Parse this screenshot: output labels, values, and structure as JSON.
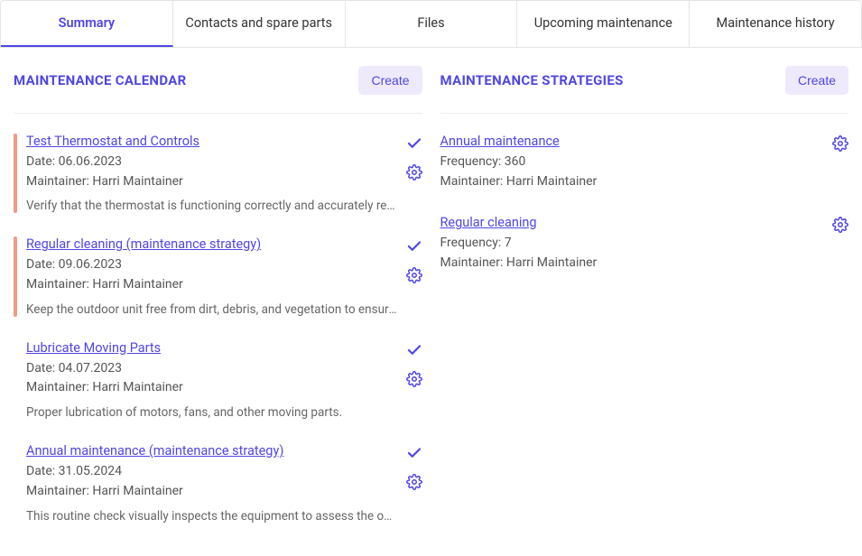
{
  "tabs": [
    {
      "label": "Summary",
      "active": true
    },
    {
      "label": "Contacts and spare parts",
      "active": false
    },
    {
      "label": "Files",
      "active": false
    },
    {
      "label": "Upcoming maintenance",
      "active": false
    },
    {
      "label": "Maintenance history",
      "active": false
    }
  ],
  "calendar": {
    "title": "MAINTENANCE CALENDAR",
    "create_label": "Create",
    "items": [
      {
        "title": "Test Thermostat and Controls",
        "date_label": "Date: 06.06.2023",
        "maintainer_label": "Maintainer: Harri Maintainer",
        "desc": "Verify that the thermostat is functioning correctly and accurately reflects temperature settings.",
        "accent": "red"
      },
      {
        "title": "Regular cleaning (maintenance strategy)",
        "date_label": "Date: 09.06.2023",
        "maintainer_label": "Maintainer: Harri Maintainer",
        "desc": "Keep the outdoor unit free from dirt, debris, and vegetation to ensure proper airflow.",
        "accent": "red"
      },
      {
        "title": "Lubricate Moving Parts",
        "date_label": "Date: 04.07.2023",
        "maintainer_label": "Maintainer: Harri Maintainer",
        "desc": "Proper lubrication of motors, fans, and other moving parts.",
        "accent": "none"
      },
      {
        "title": "Annual maintenance (maintenance strategy)",
        "date_label": "Date: 31.05.2024",
        "maintainer_label": "Maintainer: Harri Maintainer",
        "desc": "This routine check visually inspects the equipment to assess the overall condition and performance.",
        "accent": "none"
      }
    ]
  },
  "strategies": {
    "title": "MAINTENANCE STRATEGIES",
    "create_label": "Create",
    "items": [
      {
        "title": "Annual maintenance",
        "frequency_label": "Frequency: 360",
        "maintainer_label": "Maintainer: Harri Maintainer"
      },
      {
        "title": "Regular cleaning",
        "frequency_label": "Frequency: 7",
        "maintainer_label": "Maintainer: Harri Maintainer"
      }
    ]
  }
}
